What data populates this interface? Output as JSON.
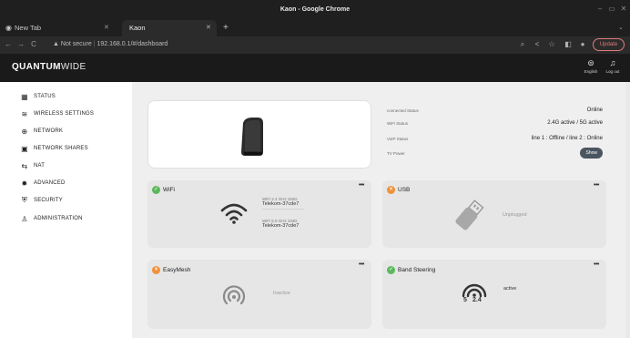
{
  "browser": {
    "window_title": "Kaon - Google Chrome",
    "tabs": [
      {
        "label": "New Tab"
      },
      {
        "label": "Kaon"
      }
    ],
    "security_label": "Not secure",
    "url": "192.168.0.1/#/dashboard",
    "update_label": "Update"
  },
  "header": {
    "logo_bold": "QUANTUM",
    "logo_light": "WIDE",
    "language_label": "English",
    "logout_label": "Log out"
  },
  "sidebar": {
    "items": [
      {
        "label": "STATUS",
        "icon": "status-icon"
      },
      {
        "label": "WIRELESS SETTINGS",
        "icon": "wifi-icon"
      },
      {
        "label": "NETWORK",
        "icon": "globe-icon"
      },
      {
        "label": "NETWORK SHARES",
        "icon": "share-icon"
      },
      {
        "label": "NAT",
        "icon": "nat-icon"
      },
      {
        "label": "ADVANCED",
        "icon": "gear-icon"
      },
      {
        "label": "SECURITY",
        "icon": "shield-icon"
      },
      {
        "label": "ADMINISTRATION",
        "icon": "admin-icon"
      }
    ]
  },
  "status": {
    "rows": [
      {
        "label": "connected Status",
        "value": "Online"
      },
      {
        "label": "WiFi Status",
        "value": "2.4G active / 5G active"
      },
      {
        "label": "VoIP Status",
        "value": "line 1 : Offline / line 2 : Online"
      },
      {
        "label": "TV Power",
        "value": "Show"
      }
    ]
  },
  "cards": {
    "wifi": {
      "title": "WiFi",
      "menu": "•••",
      "ssid_24_label": "WiFi 2.4 GHz SSID",
      "ssid_24_value": "Telekom-37cde7",
      "ssid_5_label": "WiFi 5.0 GHz SSID",
      "ssid_5_value": "Telekom-37cde7"
    },
    "usb": {
      "title": "USB",
      "menu": "•••",
      "status": "Unplugged"
    },
    "easymesh": {
      "title": "EasyMesh",
      "menu": "•••",
      "status": "Inactive"
    },
    "band_steering": {
      "title": "Band Steering",
      "menu": "•••",
      "status": "active",
      "band_5": "5",
      "band_24": "2.4"
    }
  },
  "colors": {
    "ok": "#5cb85c",
    "warn": "#f0913a",
    "header_bg": "#1a1a1a",
    "main_bg": "#efefef"
  }
}
